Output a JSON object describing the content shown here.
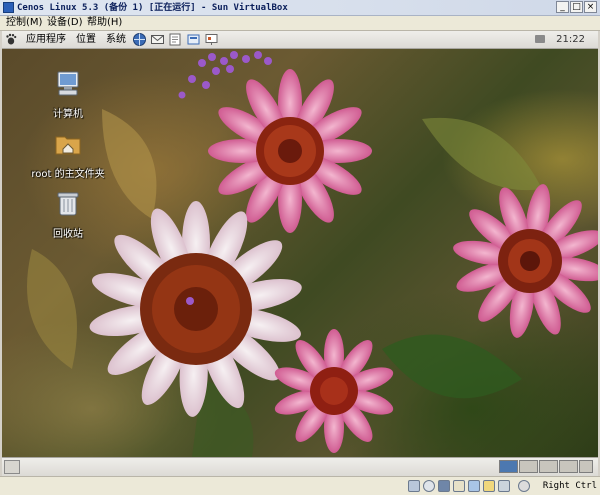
{
  "window": {
    "title": "Cenos Linux 5.3 (备份 1) [正在运行] - Sun VirtualBox",
    "controls": {
      "minimize": "_",
      "maximize": "□",
      "close": "×"
    }
  },
  "vbox_menu": {
    "items": [
      "控制(M)",
      "设备(D)",
      "帮助(H)"
    ]
  },
  "gnome_panel": {
    "menus": [
      "应用程序",
      "位置",
      "系统"
    ],
    "launchers": [
      "web-browser-icon",
      "email-icon",
      "notes-icon",
      "office-icon"
    ],
    "clock": "21:22"
  },
  "desktop": {
    "icons": [
      {
        "label": "计算机",
        "icon": "computer-icon"
      },
      {
        "label": "root 的主文件夹",
        "icon": "home-folder-icon"
      },
      {
        "label": "回收站",
        "icon": "trash-icon"
      }
    ]
  },
  "bottom_panel": {
    "workspaces": 4,
    "active_workspace": 1
  },
  "vbox_status": {
    "indicators": [
      "hard-disk-icon",
      "cd-icon",
      "floppy-icon",
      "usb-icon",
      "network-icon",
      "shared-folder-icon",
      "vrdp-icon",
      "mouse-integration-icon"
    ],
    "host_key": "Right Ctrl"
  },
  "colors": {
    "titlebar": "#dfe6f1",
    "title_text": "#0a1e5a",
    "active_workspace": "#4c78b0",
    "flower_pink": "#d2558c",
    "flower_center": "#8a2410"
  }
}
